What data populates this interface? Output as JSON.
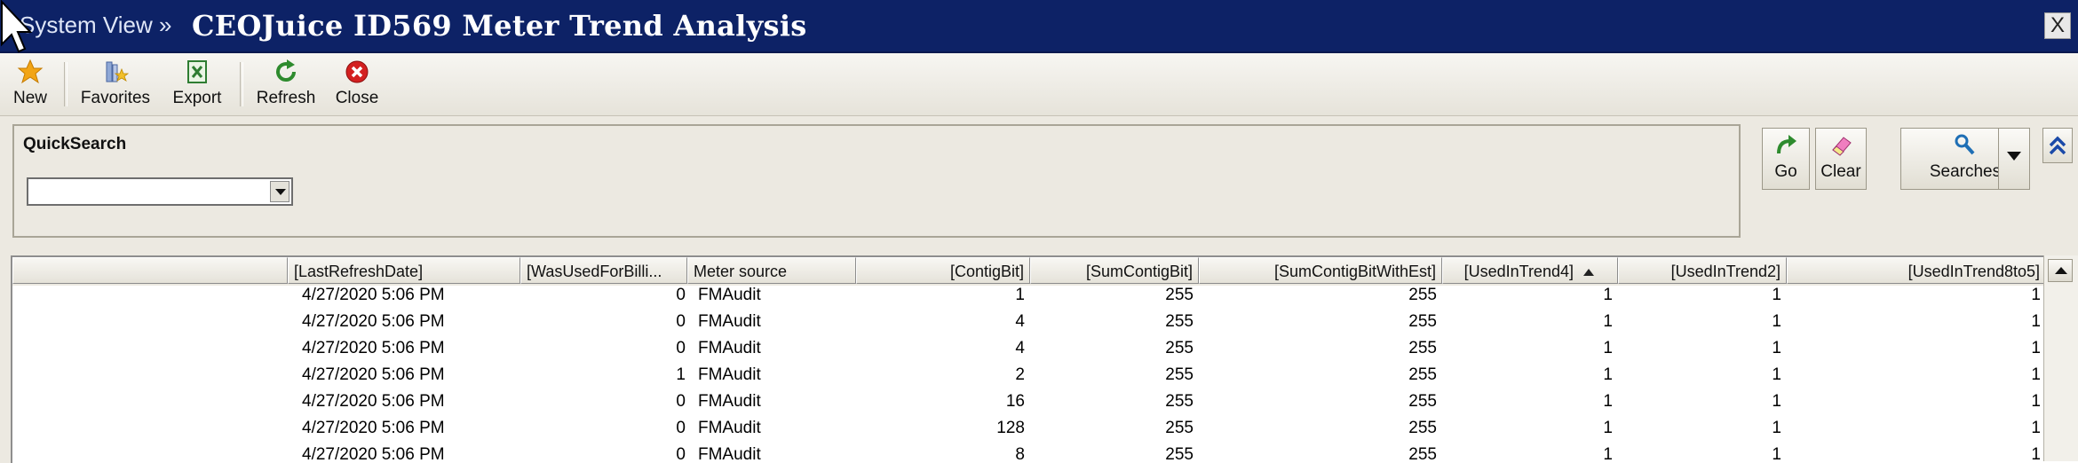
{
  "titlebar": {
    "breadcrumb": "System View »",
    "title": "CEOJuice ID569 Meter Trend Analysis",
    "close": "X"
  },
  "toolbar": {
    "new": "New",
    "favorites": "Favorites",
    "export": "Export",
    "refresh": "Refresh",
    "close": "Close"
  },
  "quicksearch": {
    "label": "QuickSearch",
    "value": ""
  },
  "search_buttons": {
    "go": "Go",
    "clear": "Clear",
    "searches": "Searches"
  },
  "grid": {
    "headers": {
      "c0": "",
      "c1": "[LastRefreshDate]",
      "c2": "[WasUsedForBilli...",
      "c3": "Meter source",
      "c4": "[ContigBit]",
      "c5": "[SumContigBit]",
      "c6": "[SumContigBitWithEst]",
      "c7": "[UsedInTrend4]",
      "c8": "[UsedInTrend2]",
      "c9": "[UsedInTrend8to5]"
    },
    "rows": [
      {
        "c1": "4/27/2020 5:06 PM",
        "c2": "0",
        "c3": "FMAudit",
        "c4": "1",
        "c5": "255",
        "c6": "255",
        "c7": "1",
        "c8": "1",
        "c9": "1"
      },
      {
        "c1": "4/27/2020 5:06 PM",
        "c2": "0",
        "c3": "FMAudit",
        "c4": "4",
        "c5": "255",
        "c6": "255",
        "c7": "1",
        "c8": "1",
        "c9": "1"
      },
      {
        "c1": "4/27/2020 5:06 PM",
        "c2": "0",
        "c3": "FMAudit",
        "c4": "4",
        "c5": "255",
        "c6": "255",
        "c7": "1",
        "c8": "1",
        "c9": "1"
      },
      {
        "c1": "4/27/2020 5:06 PM",
        "c2": "1",
        "c3": "FMAudit",
        "c4": "2",
        "c5": "255",
        "c6": "255",
        "c7": "1",
        "c8": "1",
        "c9": "1"
      },
      {
        "c1": "4/27/2020 5:06 PM",
        "c2": "0",
        "c3": "FMAudit",
        "c4": "16",
        "c5": "255",
        "c6": "255",
        "c7": "1",
        "c8": "1",
        "c9": "1"
      },
      {
        "c1": "4/27/2020 5:06 PM",
        "c2": "0",
        "c3": "FMAudit",
        "c4": "128",
        "c5": "255",
        "c6": "255",
        "c7": "1",
        "c8": "1",
        "c9": "1"
      },
      {
        "c1": "4/27/2020 5:06 PM",
        "c2": "0",
        "c3": "FMAudit",
        "c4": "8",
        "c5": "255",
        "c6": "255",
        "c7": "1",
        "c8": "1",
        "c9": "1"
      }
    ]
  },
  "colors": {
    "titlebar": "#0d2266",
    "toolbar": "#ece9e1"
  }
}
